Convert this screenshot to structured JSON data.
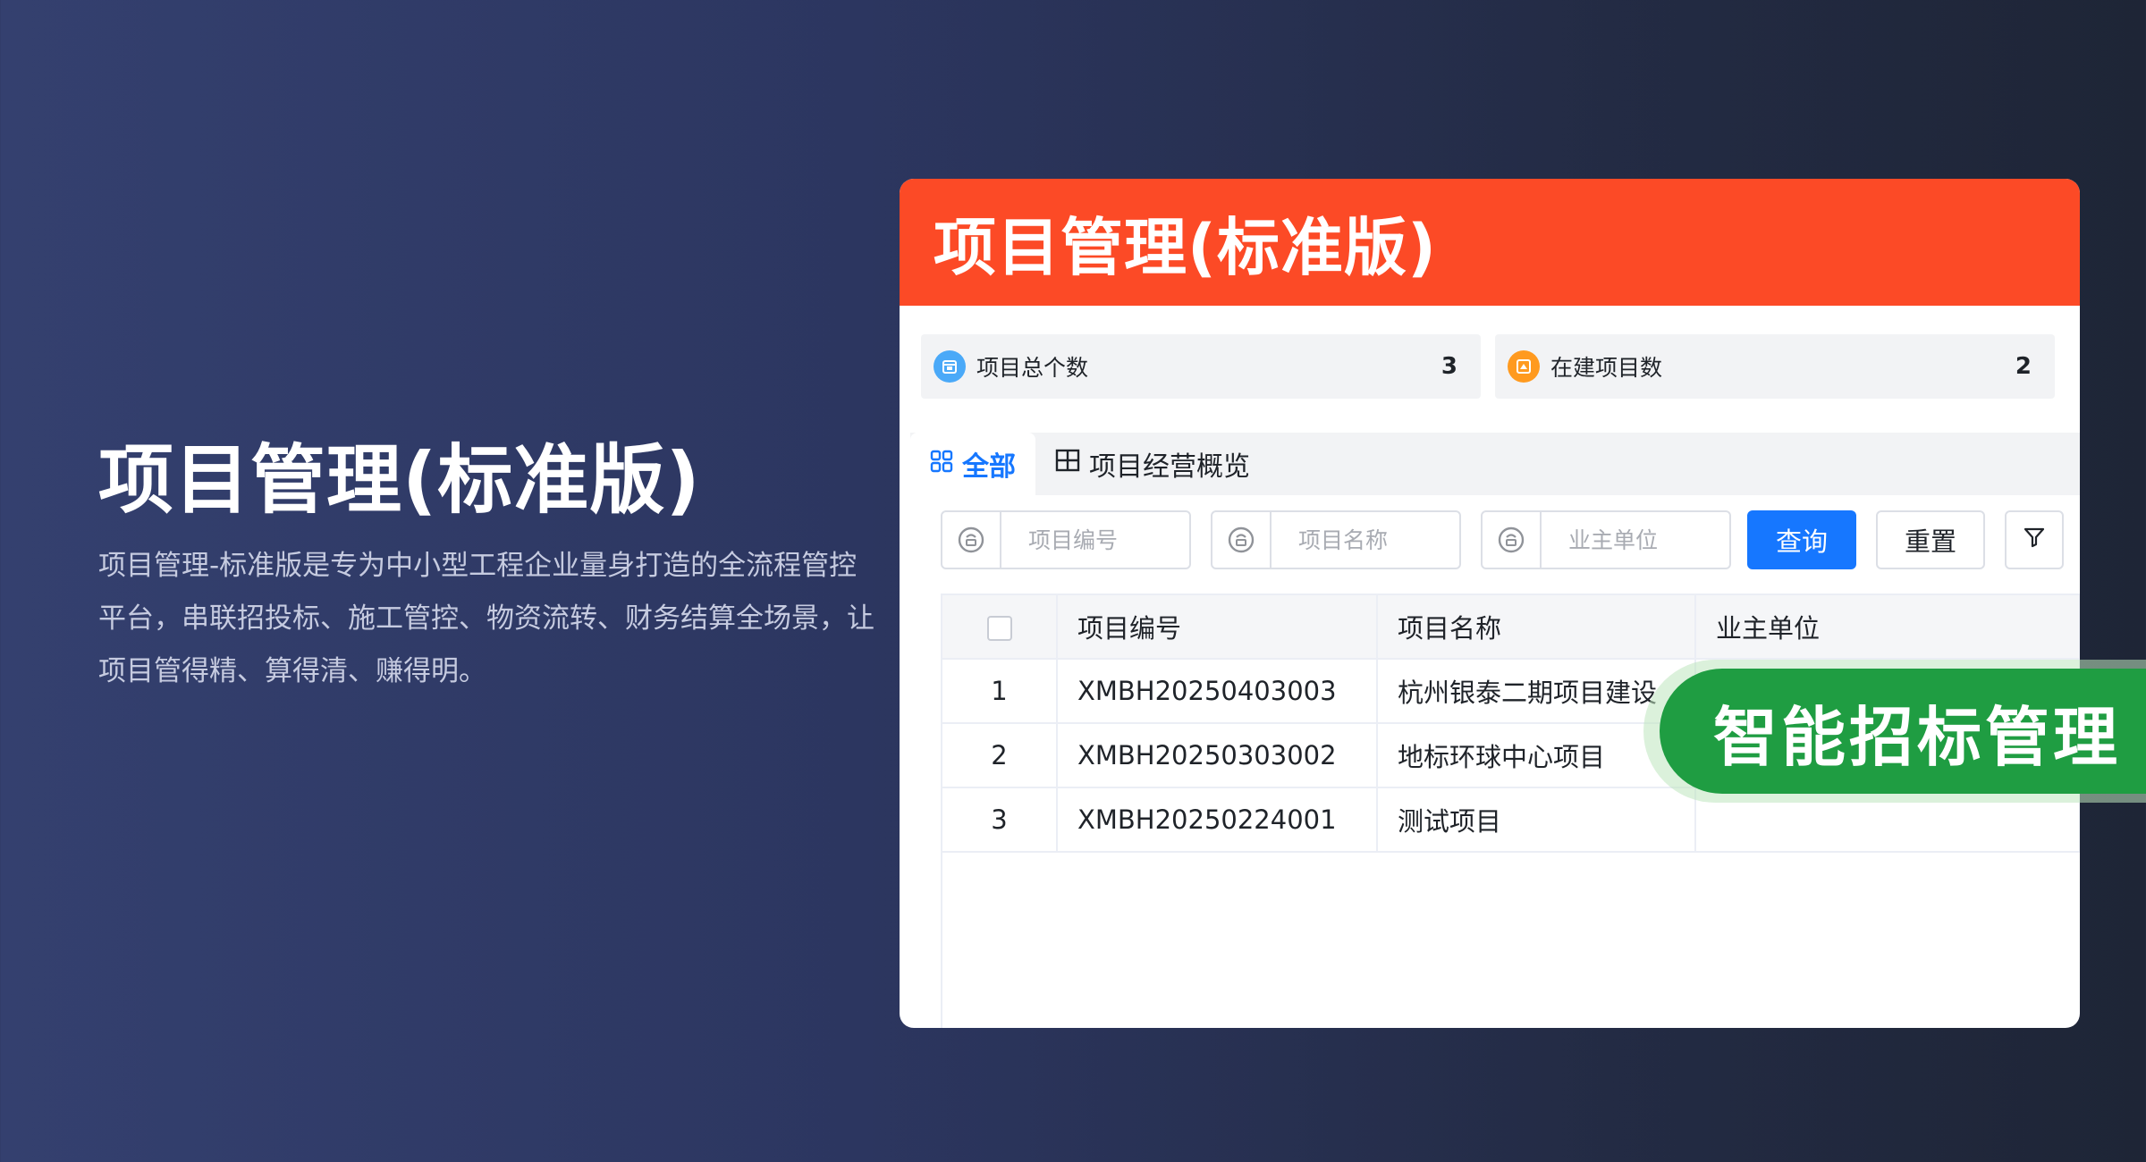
{
  "hero": {
    "title": "项目管理(标准版)",
    "description": "项目管理-标准版是专为中小型工程企业量身打造的全流程管控平台，串联招投标、施工管控、物资流转、财务结算全场景，让项目管得精、算得清、赚得明。"
  },
  "panel": {
    "header_title": "项目管理(标准版)",
    "stats": [
      {
        "label": "项目总个数",
        "value": "3",
        "icon": "calendar-icon",
        "color": "#4aa9f8"
      },
      {
        "label": "在建项目数",
        "value": "2",
        "icon": "build-icon",
        "color": "#ff9a1f"
      }
    ],
    "tabs": [
      {
        "label": "全部",
        "icon": "grid-icon",
        "active": true
      },
      {
        "label": "项目经营概览",
        "icon": "table-icon",
        "active": false
      }
    ],
    "filters": [
      {
        "placeholder": "项目编号",
        "icon": "contains-icon"
      },
      {
        "placeholder": "项目名称",
        "icon": "contains-icon"
      },
      {
        "placeholder": "业主单位",
        "icon": "contains-icon"
      }
    ],
    "buttons": {
      "query": "查询",
      "reset": "重置",
      "filter_icon": "funnel-icon"
    },
    "table": {
      "columns": [
        "项目编号",
        "项目名称",
        "业主单位"
      ],
      "rows": [
        {
          "index": "1",
          "code": "XMBH20250403003",
          "name": "杭州银泰二期项目建设",
          "owner": ""
        },
        {
          "index": "2",
          "code": "XMBH20250303002",
          "name": "地标环球中心项目",
          "owner": ""
        },
        {
          "index": "3",
          "code": "XMBH20250224001",
          "name": "测试项目",
          "owner": ""
        }
      ]
    }
  },
  "badge": {
    "label": "智能招标管理",
    "color": "#1f9d42"
  },
  "colors": {
    "header": "#fc4a26",
    "primary": "#1677ff"
  }
}
